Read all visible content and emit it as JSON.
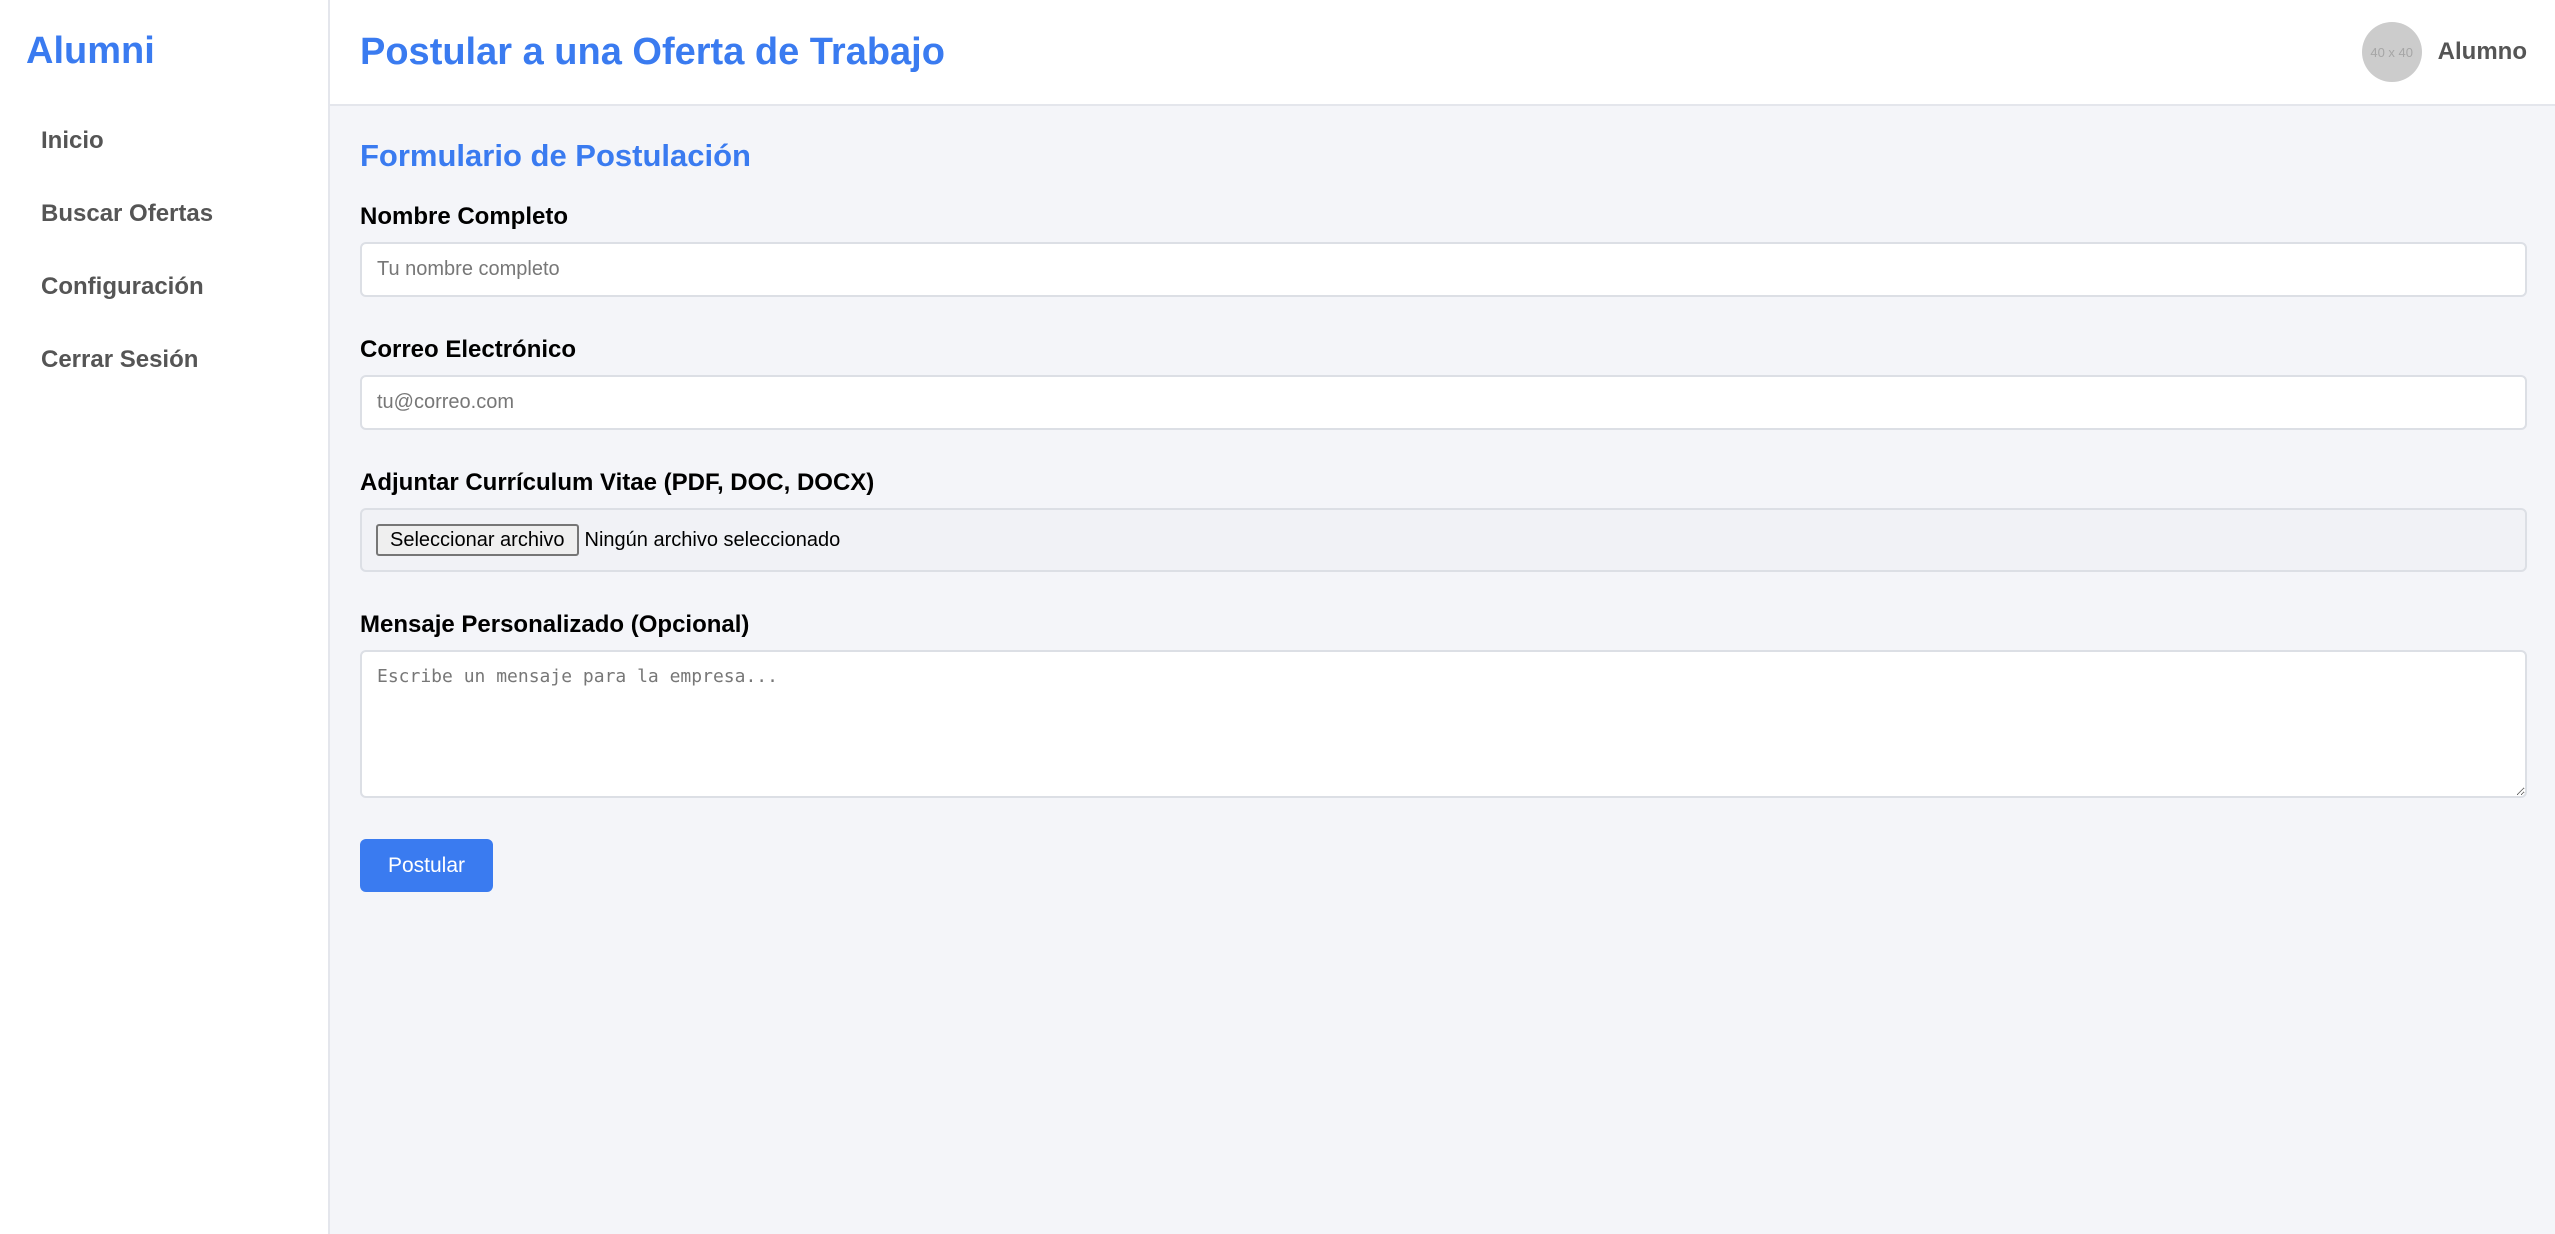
{
  "sidebar": {
    "brand": "Alumni",
    "items": [
      {
        "label": "Inicio"
      },
      {
        "label": "Buscar Ofertas"
      },
      {
        "label": "Configuración"
      },
      {
        "label": "Cerrar Sesión"
      }
    ]
  },
  "header": {
    "title": "Postular a una Oferta de Trabajo",
    "avatar_text": "40 x 40",
    "user_name": "Alumno"
  },
  "form": {
    "title": "Formulario de Postulación",
    "name": {
      "label": "Nombre Completo",
      "placeholder": "Tu nombre completo",
      "value": ""
    },
    "email": {
      "label": "Correo Electrónico",
      "placeholder": "tu@correo.com",
      "value": ""
    },
    "cv": {
      "label": "Adjuntar Currículum Vitae (PDF, DOC, DOCX)",
      "button_label": "Seleccionar archivo",
      "status": "Ningún archivo seleccionado"
    },
    "message": {
      "label": "Mensaje Personalizado (Opcional)",
      "placeholder": "Escribe un mensaje para la empresa..."
    },
    "submit_label": "Postular"
  },
  "colors": {
    "accent": "#3a7bf0",
    "sidebar_text": "#555555",
    "background": "#f4f5f9"
  }
}
